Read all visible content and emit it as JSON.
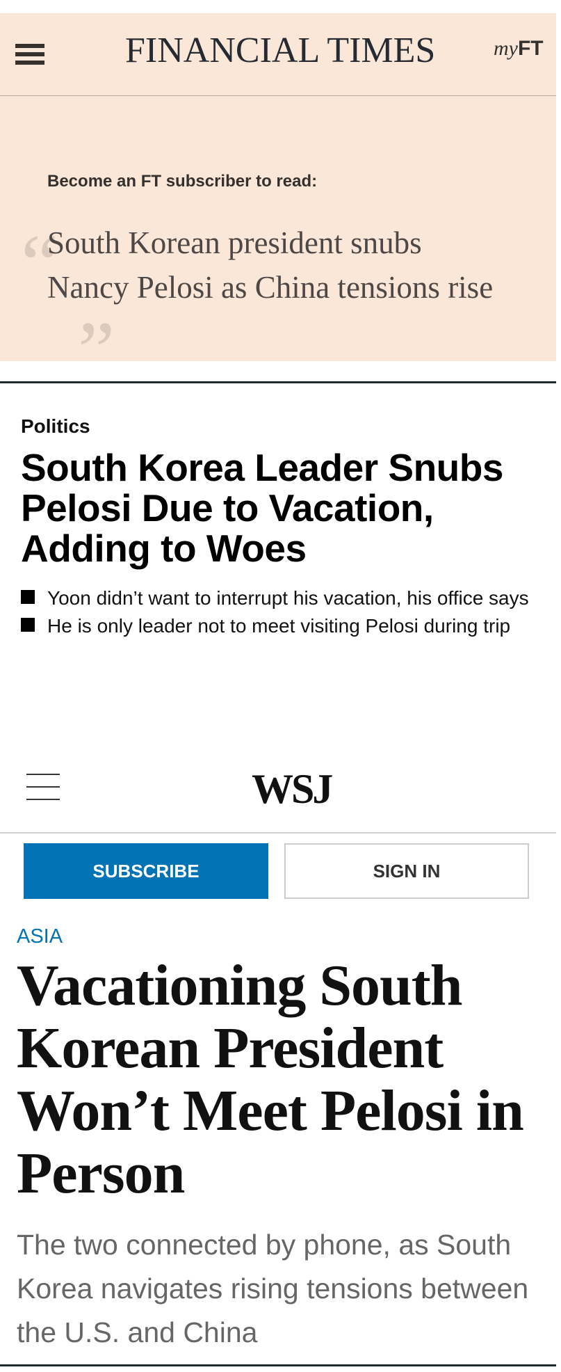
{
  "ft": {
    "logo": "FINANCIAL TIMES",
    "myft_my": "my",
    "myft_ft": "FT",
    "cta": "Become an FT subscriber to read:",
    "quote_open": "“",
    "quote_close": "”",
    "headline": "South Korean president snubs Nancy Pelosi as China tensions rise",
    "icons": [
      "hamburger-menu-icon",
      "quote-open-icon",
      "quote-close-icon"
    ]
  },
  "middle_article": {
    "kicker": "Politics",
    "headline": "South Korea Leader Snubs Pelosi Due to Vacation, Adding to Woes",
    "bullets": [
      "Yoon didn’t want to interrupt his vacation, his office says",
      "He is only leader not to meet visiting Pelosi during trip"
    ]
  },
  "wsj": {
    "logo": "WSJ",
    "subscribe_label": "SUBSCRIBE",
    "signin_label": "SIGN IN",
    "section": "ASIA",
    "headline": "Vacationing South Korean President Won’t Meet Pelosi in Person",
    "dek": "The two connected by phone, as South Korea navigates rising tensions between the U.S. and China",
    "colors": {
      "accent": "#0274b6"
    },
    "icons": [
      "hamburger-menu-icon"
    ]
  },
  "colors": {
    "ft_background": "#fbe7d8",
    "divider": "#1d2a2f"
  }
}
